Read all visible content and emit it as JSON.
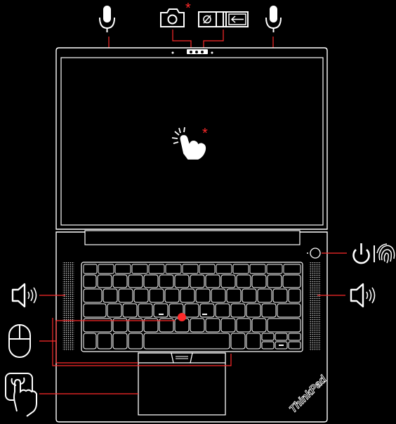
{
  "diagram": {
    "brand_text": "ThinkPad",
    "footnote_marker": "*",
    "colors": {
      "background": "#000000",
      "lines": "#ffffff",
      "callouts": "#ff2a2a",
      "trackpoint": "#ff2a2a"
    },
    "icons": {
      "top": [
        "microphone-icon",
        "camera-icon",
        "privacy-shutter-icon",
        "microphone-icon"
      ],
      "screen": "touch-icon",
      "right": [
        "power-button-icon",
        "fingerprint-icon",
        "speaker-icon"
      ],
      "left": [
        "speaker-icon",
        "mouse-icon",
        "touchpad-icon"
      ]
    }
  }
}
